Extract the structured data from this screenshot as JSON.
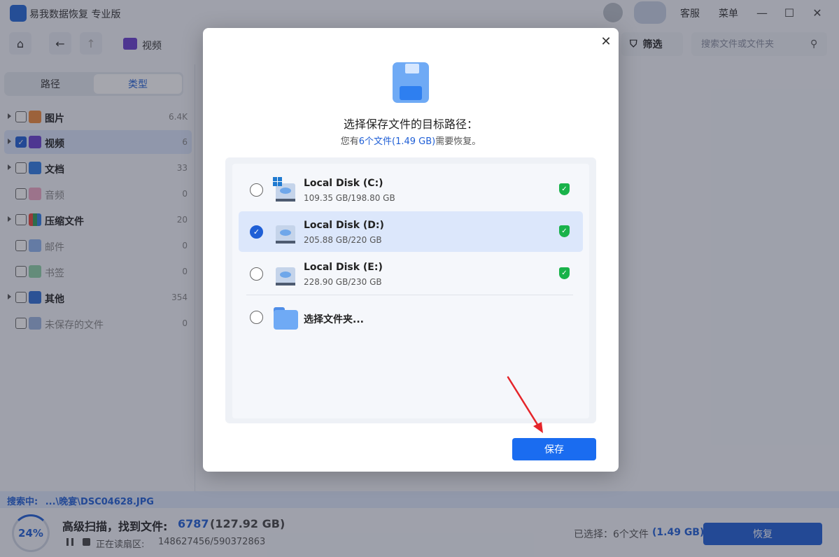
{
  "app": {
    "title": "易我数据恢复 专业版",
    "service_label": "客服",
    "menu_label": "菜单"
  },
  "toolbar": {
    "breadcrumb": "视频",
    "filter_label": "筛选",
    "search_placeholder": "搜索文件或文件夹"
  },
  "sidebar": {
    "tabs": [
      {
        "label": "路径"
      },
      {
        "label": "类型"
      }
    ],
    "categories": [
      {
        "label": "图片",
        "count": "6.4K"
      },
      {
        "label": "视频",
        "count": "6"
      },
      {
        "label": "文档",
        "count": "33"
      },
      {
        "label": "音频",
        "count": "0"
      },
      {
        "label": "压缩文件",
        "count": "20"
      },
      {
        "label": "邮件",
        "count": "0"
      },
      {
        "label": "书签",
        "count": "0"
      },
      {
        "label": "其他",
        "count": "354"
      },
      {
        "label": "未保存的文件",
        "count": "0"
      }
    ]
  },
  "status": {
    "searching_label": "搜索中:",
    "searching_path": "...\\晚宴\\DSC04628.JPG",
    "progress": "24%",
    "scan_title": "高级扫描，找到文件:",
    "found_count": "6787",
    "found_size": "(127.92 GB)",
    "reading_label": "正在读扇区:",
    "reading_value": "148627456/590372863",
    "selected_label": "已选择：6个文件",
    "selected_size": "(1.49 GB)",
    "recover_label": "恢复"
  },
  "dialog": {
    "title": "选择保存文件的目标路径：",
    "subtitle_prefix": "您有",
    "subtitle_highlight": "6个文件(1.49 GB)",
    "subtitle_suffix": "需要恢复。",
    "disks": [
      {
        "name": "Local Disk (C:)",
        "size": "109.35 GB/198.80 GB"
      },
      {
        "name": "Local Disk (D:)",
        "size": "205.88 GB/220 GB"
      },
      {
        "name": "Local Disk (E:)",
        "size": "228.90 GB/230 GB"
      }
    ],
    "folder_option": "选择文件夹...",
    "save_label": "保存"
  },
  "colors": {
    "accent": "#1f5fd6",
    "save_button": "#1a6cf0",
    "shield": "#19b24a",
    "arrow": "#e5252a"
  }
}
